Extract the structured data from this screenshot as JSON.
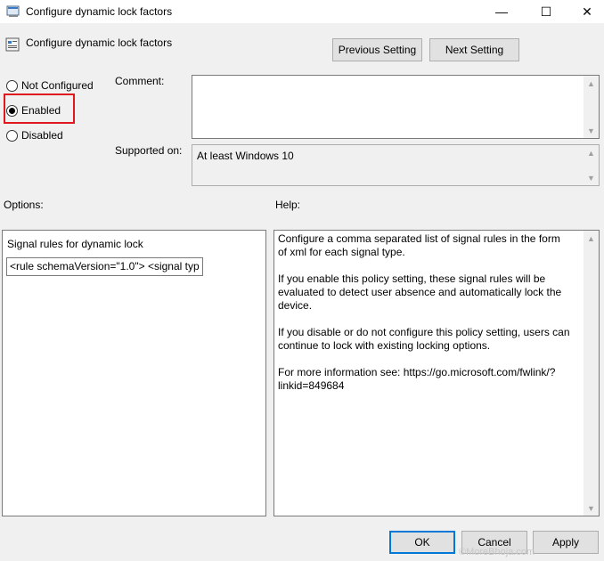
{
  "window": {
    "title": "Configure dynamic lock factors",
    "minimize_glyph": "—",
    "maximize_glyph": "☐",
    "close_glyph": "✕"
  },
  "header": {
    "title": "Configure dynamic lock factors",
    "prev_label": "Previous Setting",
    "next_label": "Next Setting"
  },
  "state": {
    "options": [
      {
        "label": "Not Configured",
        "checked": false
      },
      {
        "label": "Enabled",
        "checked": true
      },
      {
        "label": "Disabled",
        "checked": false
      }
    ]
  },
  "comment": {
    "label": "Comment:",
    "value": ""
  },
  "supported": {
    "label": "Supported on:",
    "value": "At least Windows 10"
  },
  "options_section": {
    "label": "Options:",
    "signal_label": "Signal rules for dynamic lock",
    "signal_value": "<rule schemaVersion=\"1.0\"> <signal typ"
  },
  "help_section": {
    "label": "Help:",
    "paragraphs": [
      "Configure a comma separated list of signal rules in the form of xml for each signal type.",
      "If you enable this policy setting, these signal rules will be evaluated to detect user absence and automatically lock the device.",
      "If you disable or do not configure this policy setting, users can continue to lock with existing locking options.",
      "For more information see: https://go.microsoft.com/fwlink/?linkid=849684"
    ]
  },
  "footer": {
    "ok": "OK",
    "cancel": "Cancel",
    "apply": "Apply"
  },
  "watermark": "©MoreBhoja.com",
  "colors": {
    "highlight": "#e0181e",
    "accent": "#0078d7"
  }
}
